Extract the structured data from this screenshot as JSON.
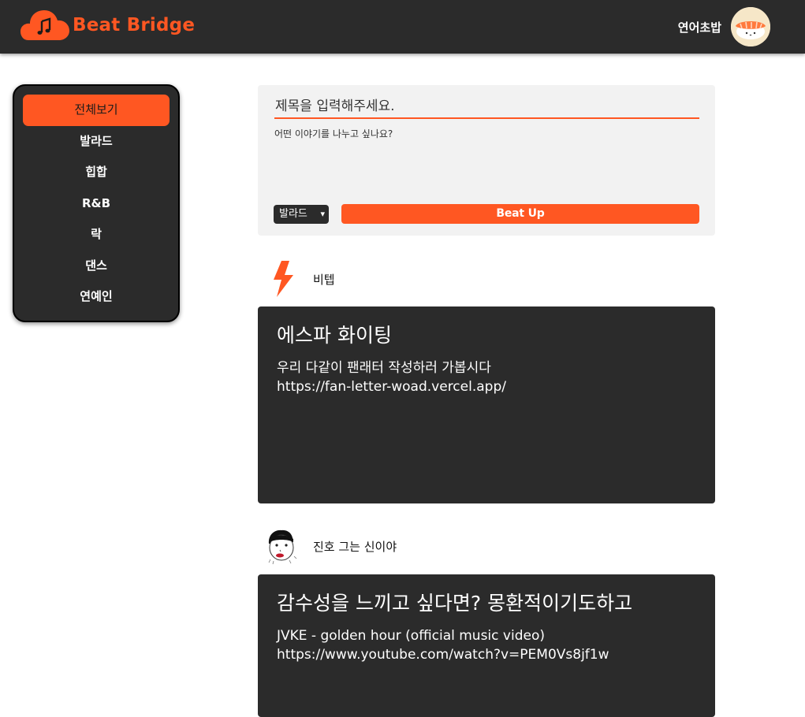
{
  "app": {
    "name": "Beat Bridge",
    "brand_color": "#ff5722",
    "dark_color": "#2b2b2b"
  },
  "header": {
    "user_name": "연어초밥",
    "avatar_icon": "salmon-sushi-avatar"
  },
  "sidebar": {
    "items": [
      {
        "label": "전체보기",
        "active": true
      },
      {
        "label": "발라드",
        "active": false
      },
      {
        "label": "힙합",
        "active": false
      },
      {
        "label": "R&B",
        "active": false
      },
      {
        "label": "락",
        "active": false
      },
      {
        "label": "댄스",
        "active": false
      },
      {
        "label": "연예인",
        "active": false
      }
    ]
  },
  "composer": {
    "title_placeholder": "제목을 입력해주세요.",
    "body_placeholder": "어떤 이야기를 나누고 싶나요?",
    "genre_selected": "발라드",
    "submit_label": "Beat Up"
  },
  "posts": [
    {
      "author": "비텝",
      "author_icon": "lightning-bolt-icon",
      "title": "에스파 화이팅",
      "body": "우리 다같이 팬래터 작성하러 가봅시다\nhttps://fan-letter-woad.vercel.app/"
    },
    {
      "author": "진호 그는 신이야",
      "author_icon": "cartoon-face-avatar",
      "title": "감수성을 느끼고 싶다면? 몽환적이기도하고",
      "body": "JVKE - golden hour (official music video)\nhttps://www.youtube.com/watch?v=PEM0Vs8jf1w"
    }
  ]
}
